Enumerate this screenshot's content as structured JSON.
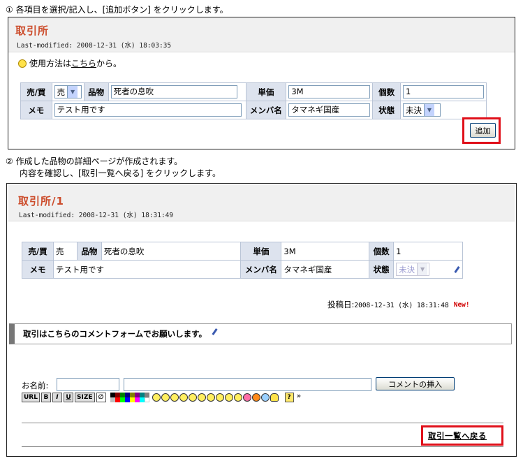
{
  "steps": {
    "step1": "① 各項目を選択/記入し、[追加ボタン] をクリックします。",
    "step2_line1": "② 作成した品物の詳細ページが作成されます。",
    "step2_line2": "内容を確認し、[取引一覧へ戻る] をクリックします。"
  },
  "panel1": {
    "title": "取引所",
    "last_modified": "Last-modified: 2008-12-31 (水) 18:03:35",
    "help_prefix": "使用方法は",
    "help_link": "こちら",
    "help_suffix": "から。",
    "labels": {
      "buysell": "売/買",
      "item": "品物",
      "price": "単価",
      "qty": "個数",
      "memo": "メモ",
      "member": "メンバ名",
      "status": "状態"
    },
    "values": {
      "buysell": "売",
      "item": "死者の息吹",
      "price": "3M",
      "qty": "1",
      "memo": "テスト用です",
      "member": "タマネギ国産",
      "status": "未決"
    },
    "add_button": "追加"
  },
  "panel2": {
    "title": "取引所/1",
    "last_modified": "Last-modified: 2008-12-31 (水) 18:31:49",
    "labels": {
      "buysell": "売/買",
      "item": "品物",
      "price": "単価",
      "qty": "個数",
      "memo": "メモ",
      "member": "メンバ名",
      "status": "状態"
    },
    "values": {
      "buysell": "売",
      "item": "死者の息吹",
      "price": "3M",
      "qty": "1",
      "memo": "テスト用です",
      "member": "タマネギ国産",
      "status": "未決"
    },
    "posted_label": "投稿日:",
    "posted_date": "2008-12-31 (水) 18:31:48",
    "new_badge": "New!",
    "comment_heading": "取引はこちらのコメントフォームでお願いします。",
    "name_label": "お名前:",
    "insert_button": "コメントの挿入",
    "toolbar": [
      "URL",
      "B",
      "I",
      "U",
      "SIZE"
    ],
    "more_glyph": "»",
    "back_link": "取引一覧へ戻る"
  },
  "colors": {
    "title": "#cc4c2b",
    "label_bg": "#dde3ee",
    "highlight": "#e0101a",
    "new": "#d00000"
  }
}
